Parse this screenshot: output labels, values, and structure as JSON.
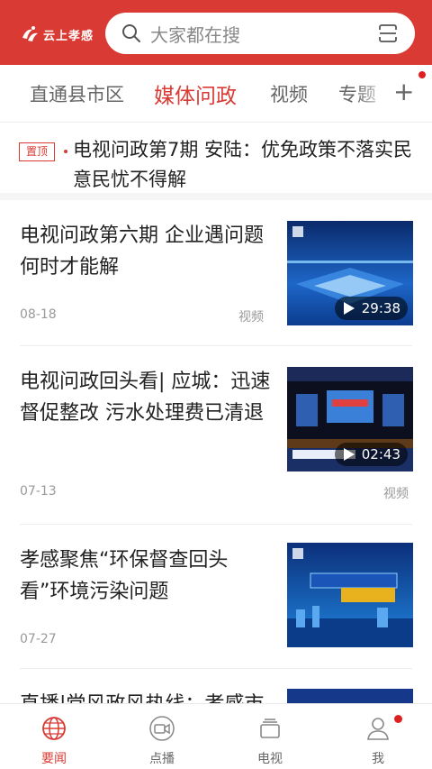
{
  "header": {
    "logo_text": "云上孝感",
    "search_placeholder": "大家都在搜",
    "colors": {
      "brand": "#d93a33",
      "white": "#ffffff"
    }
  },
  "tabs": [
    {
      "label": "直通县市区",
      "active": false
    },
    {
      "label": "媒体问政",
      "active": true
    },
    {
      "label": "视频",
      "active": false
    },
    {
      "label": "专题",
      "active": false
    }
  ],
  "tab_add_label": "+",
  "pinned": {
    "badge": "置顶",
    "title": "电视问政第7期  安陆：优免政策不落实民意民忧不得解"
  },
  "news": [
    {
      "title": "电视问政第六期 企业遇问题何时才能解",
      "date": "08-18",
      "type": "视频",
      "duration": "29:38",
      "thumb_icon": "stage-blue-thumbnail"
    },
    {
      "title": "电视问政回头看| 应城：迅速督促整改 污水处理费已清退",
      "date": "07-13",
      "type": "视频",
      "duration": "02:43",
      "thumb_icon": "studio-stage-thumbnail"
    },
    {
      "title": "孝感聚焦“环保督查回头看”环境污染问题",
      "date": "07-27",
      "type": "",
      "duration": "",
      "thumb_icon": "city-title-thumbnail"
    },
    {
      "title": "直播|党风政风热线：孝感市",
      "date": "",
      "type": "",
      "duration": "",
      "thumb_icon": "partial-thumbnail"
    }
  ],
  "bottom_nav": [
    {
      "label": "要闻",
      "icon": "globe-icon",
      "active": true
    },
    {
      "label": "点播",
      "icon": "video-camera-icon",
      "active": false
    },
    {
      "label": "电视",
      "icon": "tv-stack-icon",
      "active": false
    },
    {
      "label": "我",
      "icon": "user-icon",
      "active": false,
      "dot": true
    }
  ]
}
